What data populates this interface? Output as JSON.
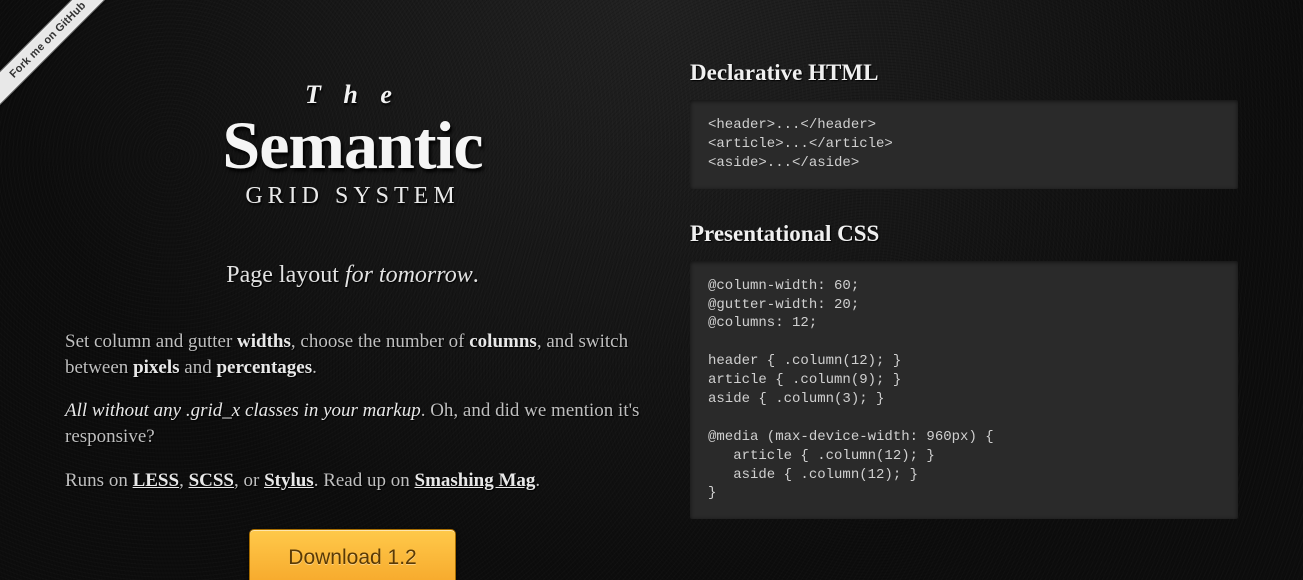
{
  "ribbon": {
    "label": "Fork me on GitHub"
  },
  "hero": {
    "the": "T h e",
    "semantic": "Semantic",
    "grid": "GRID SYSTEM"
  },
  "tagline": {
    "prefix": "Page layout ",
    "em": "for tomorrow",
    "suffix": "."
  },
  "copy": {
    "p1_a": "Set column and gutter ",
    "p1_b": "widths",
    "p1_c": ", choose the number of ",
    "p1_d": "columns",
    "p1_e": ", and switch between ",
    "p1_f": "pixels",
    "p1_g": " and ",
    "p1_h": "percentages",
    "p1_i": ".",
    "p2_a": "All without any .grid_x classes in your markup",
    "p2_b": ". Oh, and did we mention it's responsive?",
    "p3_a": "Runs on ",
    "p3_link1": "LESS",
    "p3_b": ", ",
    "p3_link2": "SCSS",
    "p3_c": ", or ",
    "p3_link3": "Stylus",
    "p3_d": ". Read up on ",
    "p3_link4": "Smashing Mag",
    "p3_e": "."
  },
  "download": {
    "label": "Download 1.2"
  },
  "right": {
    "section1_title": "Declarative HTML",
    "code1": "<header>...</header>\n<article>...</article>\n<aside>...</aside>",
    "section2_title": "Presentational CSS",
    "code2": "@column-width: 60;\n@gutter-width: 20;\n@columns: 12;\n\nheader { .column(12); }\narticle { .column(9); }\naside { .column(3); }\n\n@media (max-device-width: 960px) {\n   article { .column(12); }\n   aside { .column(12); }\n}"
  }
}
